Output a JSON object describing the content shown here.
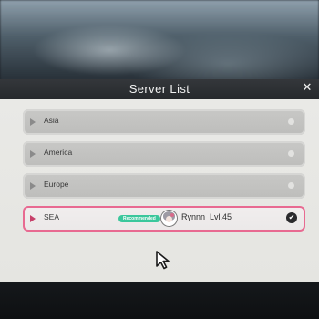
{
  "dialog": {
    "title": "Server List",
    "close_glyph": "✕"
  },
  "servers": [
    {
      "name": "Asia"
    },
    {
      "name": "America"
    },
    {
      "name": "Europe"
    },
    {
      "name": "SEA",
      "badge": "Recommended",
      "player_name": "Rynnn",
      "player_level": "Lvl.45"
    }
  ],
  "selected_server": "SEA",
  "check_glyph": "✔",
  "colors": {
    "accent_pink": "#e86a91",
    "badge_green": "#3bc79c",
    "title_bar": "#2b2e32",
    "panel": "#e7e7e4"
  },
  "icons": [
    "close-icon",
    "arrow-icon",
    "check-icon",
    "avatar",
    "mouse-cursor-icon"
  ]
}
